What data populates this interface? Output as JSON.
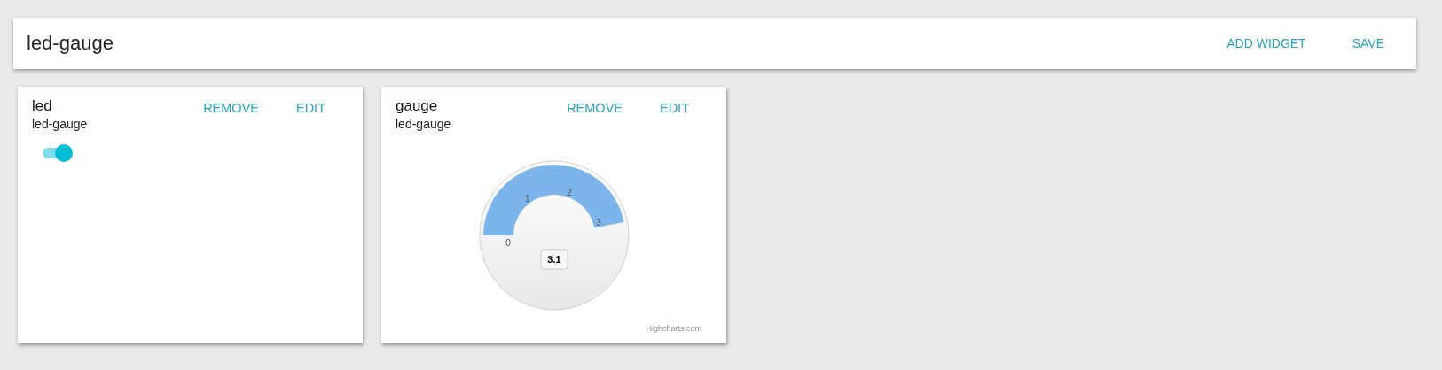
{
  "header": {
    "title": "led-gauge",
    "actions": [
      "ADD WIDGET",
      "SAVE"
    ]
  },
  "widgets": [
    {
      "kind": "led",
      "title": "led",
      "subtitle": "led-gauge",
      "actions": [
        "REMOVE",
        "EDIT"
      ],
      "on": true
    },
    {
      "kind": "gauge",
      "title": "gauge",
      "subtitle": "led-gauge",
      "actions": [
        "REMOVE",
        "EDIT"
      ],
      "gauge": {
        "level": 0.94,
        "ticks": [
          "0",
          "1",
          "2",
          "3"
        ],
        "reading": "3.1",
        "credit": "Highcharts.com"
      }
    }
  ]
}
